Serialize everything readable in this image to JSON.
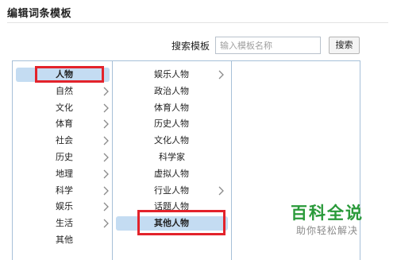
{
  "header": {
    "title": "编辑词条模板"
  },
  "search": {
    "label": "搜索模板",
    "placeholder": "输入模板名称",
    "value": "",
    "button_label": "搜索"
  },
  "categories": [
    {
      "label": "人物",
      "selected": true,
      "bold": true,
      "has_children": false
    },
    {
      "label": "自然",
      "has_children": true
    },
    {
      "label": "文化",
      "has_children": true
    },
    {
      "label": "体育",
      "has_children": true
    },
    {
      "label": "社会",
      "has_children": true
    },
    {
      "label": "历史",
      "has_children": true
    },
    {
      "label": "地理",
      "has_children": true
    },
    {
      "label": "科学",
      "has_children": true
    },
    {
      "label": "娱乐",
      "has_children": true
    },
    {
      "label": "生活",
      "has_children": true
    },
    {
      "label": "其他",
      "has_children": false
    }
  ],
  "subcategories": [
    {
      "label": "娱乐人物",
      "has_children": true
    },
    {
      "label": "政治人物",
      "has_children": false
    },
    {
      "label": "体育人物",
      "has_children": false
    },
    {
      "label": "历史人物",
      "has_children": false
    },
    {
      "label": "文化人物",
      "has_children": false
    },
    {
      "label": "科学家",
      "has_children": false,
      "centered": true
    },
    {
      "label": "虚拟人物",
      "has_children": false
    },
    {
      "label": "行业人物",
      "has_children": true
    },
    {
      "label": "话题人物",
      "has_children": false
    },
    {
      "label": "其他人物",
      "selected": true,
      "bold": true,
      "has_children": false
    }
  ],
  "watermark": {
    "main": "百科全说",
    "sub": "助你轻松解决"
  },
  "colors": {
    "selected_bg": "#c4dcf2",
    "panel_border": "#a7c0d8",
    "highlight_red": "#e3232b",
    "watermark_green": "#2a9a3a"
  }
}
